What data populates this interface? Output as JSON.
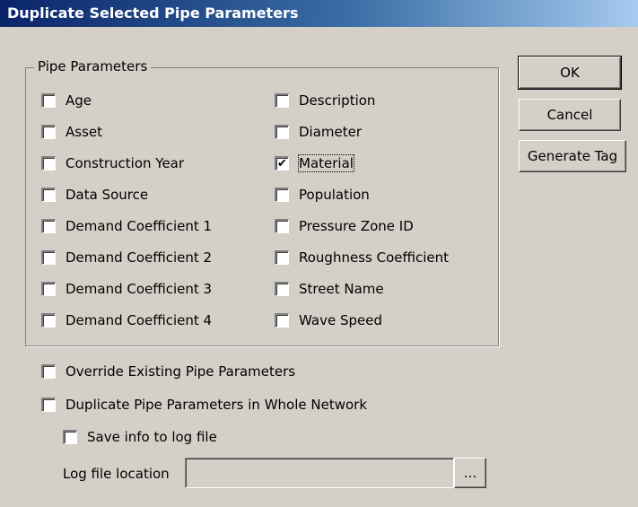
{
  "window": {
    "title": "Duplicate Selected Pipe Parameters"
  },
  "group": {
    "label": "Pipe Parameters"
  },
  "params_left": [
    {
      "label": "Age",
      "checked": false
    },
    {
      "label": "Asset",
      "checked": false
    },
    {
      "label": "Construction Year",
      "checked": false
    },
    {
      "label": "Data Source",
      "checked": false
    },
    {
      "label": "Demand Coefficient 1",
      "checked": false
    },
    {
      "label": "Demand Coefficient 2",
      "checked": false
    },
    {
      "label": "Demand Coefficient 3",
      "checked": false
    },
    {
      "label": "Demand Coefficient 4",
      "checked": false
    }
  ],
  "params_right": [
    {
      "label": "Description",
      "checked": false
    },
    {
      "label": "Diameter",
      "checked": false
    },
    {
      "label": "Material",
      "checked": true
    },
    {
      "label": "Population",
      "checked": false
    },
    {
      "label": "Pressure Zone ID",
      "checked": false
    },
    {
      "label": "Roughness Coefficient",
      "checked": false
    },
    {
      "label": "Street Name",
      "checked": false
    },
    {
      "label": "Wave Speed",
      "checked": false
    }
  ],
  "options": {
    "override": {
      "label": "Override Existing Pipe Parameters",
      "checked": false
    },
    "whole_network": {
      "label": "Duplicate Pipe Parameters in Whole Network",
      "checked": false
    },
    "save_log": {
      "label": "Save info to log file",
      "checked": false
    }
  },
  "log": {
    "label": "Log file location",
    "value": "",
    "browse_label": "..."
  },
  "buttons": {
    "ok": "OK",
    "cancel": "Cancel",
    "generate_tag": "Generate Tag"
  },
  "check_glyph": "✔"
}
